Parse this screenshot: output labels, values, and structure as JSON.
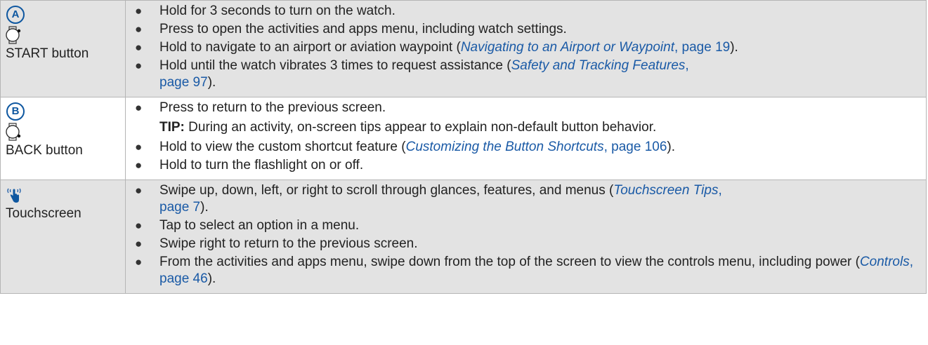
{
  "rows": [
    {
      "icon_letter": "A",
      "label": "START button",
      "items": [
        {
          "text": "Hold for 3 seconds to turn on the watch."
        },
        {
          "text": "Press to open the activities and apps menu, including watch settings."
        },
        {
          "pre": "Hold to navigate to an airport or aviation waypoint (",
          "ref": "Navigating to an Airport or Waypoint",
          "page": "page 19",
          "post": ")."
        },
        {
          "pre": "Hold until the watch vibrates 3 times to request assistance (",
          "ref": "Safety and Tracking Features",
          "page": "page 97",
          "post": ")."
        }
      ]
    },
    {
      "icon_letter": "B",
      "label": "BACK button",
      "items": [
        {
          "text": "Press to return to the previous screen."
        },
        {
          "pre": "Hold to view the custom shortcut feature (",
          "ref": "Customizing the Button Shortcuts",
          "page": "page 106",
          "post": ")."
        },
        {
          "text": "Hold to turn the flashlight on or off."
        }
      ],
      "tip": {
        "label": "TIP:",
        "text": " During an activity, on-screen tips appear to explain non-default button behavior."
      }
    },
    {
      "label": "Touchscreen",
      "items": [
        {
          "pre": "Swipe up, down, left, or right to scroll through glances, features, and menus (",
          "ref": "Touchscreen Tips",
          "page": "page 7",
          "post": ")."
        },
        {
          "text": "Tap to select an option in a menu."
        },
        {
          "text": "Swipe right to return to the previous screen."
        },
        {
          "pre": "From the activities and apps menu, swipe down from the top of the screen to view the controls menu, including power (",
          "ref": "Controls",
          "page": "page 46",
          "post": ")."
        }
      ]
    }
  ],
  "bullet_glyph": "●",
  "ref_separator": ", ",
  "icons": {
    "row1": [
      "circle-a-icon",
      "watch-start-button-icon"
    ],
    "row2": [
      "circle-b-icon",
      "watch-back-button-icon"
    ],
    "row3": [
      "touch-hand-icon"
    ]
  },
  "colors": {
    "accent": "#0e57a0",
    "link": "#1a5aa6",
    "shaded_row": "#e3e3e3",
    "border": "#b5b5b5"
  }
}
